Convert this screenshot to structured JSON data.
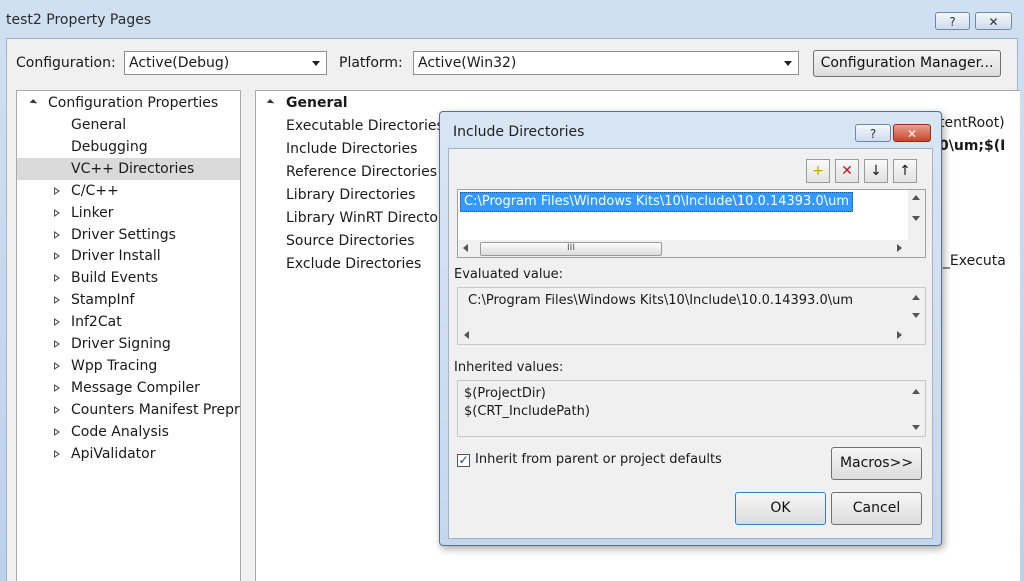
{
  "window": {
    "title": "test2 Property Pages",
    "help_glyph": "?",
    "close_glyph": "✕"
  },
  "toolbar": {
    "configuration_label": "Configuration:",
    "configuration_value": "Active(Debug)",
    "platform_label": "Platform:",
    "platform_value": "Active(Win32)",
    "config_manager_label": "Configuration Manager..."
  },
  "tree": {
    "root": "Configuration Properties",
    "items": [
      {
        "label": "General",
        "expandable": false,
        "selected": false
      },
      {
        "label": "Debugging",
        "expandable": false,
        "selected": false
      },
      {
        "label": "VC++ Directories",
        "expandable": false,
        "selected": true
      },
      {
        "label": "C/C++",
        "expandable": true,
        "selected": false
      },
      {
        "label": "Linker",
        "expandable": true,
        "selected": false
      },
      {
        "label": "Driver Settings",
        "expandable": true,
        "selected": false
      },
      {
        "label": "Driver Install",
        "expandable": true,
        "selected": false
      },
      {
        "label": "Build Events",
        "expandable": true,
        "selected": false
      },
      {
        "label": "StampInf",
        "expandable": true,
        "selected": false
      },
      {
        "label": "Inf2Cat",
        "expandable": true,
        "selected": false
      },
      {
        "label": "Driver Signing",
        "expandable": true,
        "selected": false
      },
      {
        "label": "Wpp Tracing",
        "expandable": true,
        "selected": false
      },
      {
        "label": "Message Compiler",
        "expandable": true,
        "selected": false
      },
      {
        "label": "Counters Manifest Preproc",
        "expandable": true,
        "selected": false
      },
      {
        "label": "Code Analysis",
        "expandable": true,
        "selected": false
      },
      {
        "label": "ApiValidator",
        "expandable": true,
        "selected": false
      }
    ]
  },
  "grid": {
    "header": "General",
    "rows": [
      "Executable Directories",
      "Include Directories",
      "Reference Directories",
      "Library Directories",
      "Library WinRT Directories",
      "Source Directories",
      "Exclude Directories"
    ],
    "partial_values": {
      "executable": "tentRoot)",
      "include": "0\\um;$(I",
      "exclude": "l_Executa"
    }
  },
  "dialog": {
    "title": "Include Directories",
    "help_glyph": "?",
    "close_glyph": "✕",
    "entries": [
      "C:\\Program Files\\Windows Kits\\10\\Include\\10.0.14393.0\\um"
    ],
    "hscroll_grip": "III",
    "evaluated_label": "Evaluated value:",
    "evaluated_value": "C:\\Program Files\\Windows Kits\\10\\Include\\10.0.14393.0\\um",
    "inherited_label": "Inherited values:",
    "inherited_values": [
      "$(ProjectDir)",
      "$(CRT_IncludePath)"
    ],
    "inherit_checkbox_label": "Inherit from parent or project defaults",
    "inherit_checked": true,
    "check_glyph": "✓",
    "macros_label": "Macros>>",
    "ok_label": "OK",
    "cancel_label": "Cancel",
    "tool_icons": {
      "new": "+",
      "delete": "✕",
      "down": "↓",
      "up": "↑"
    }
  }
}
